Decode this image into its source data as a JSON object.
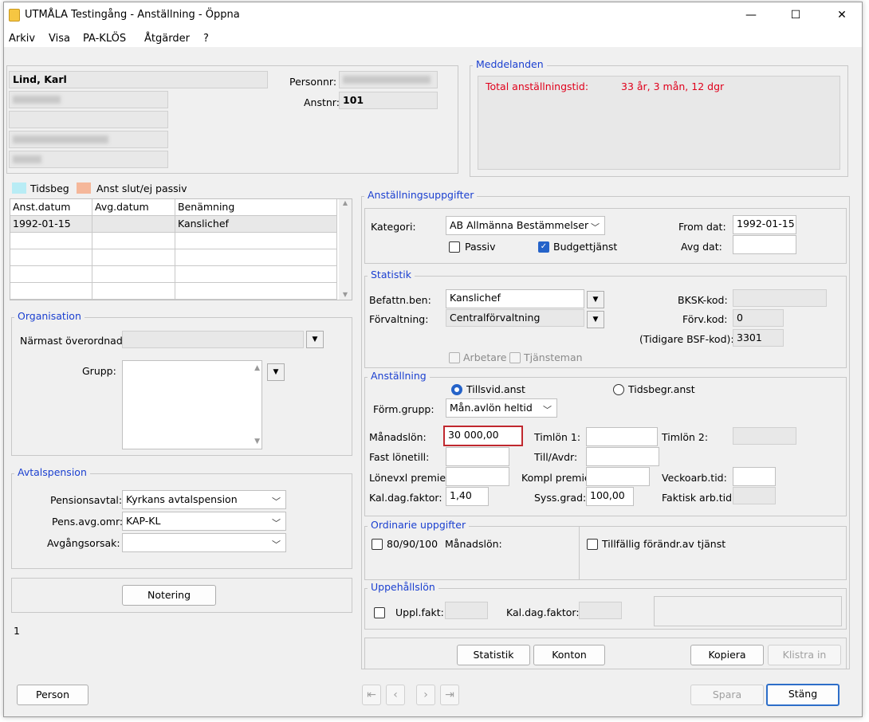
{
  "window": {
    "title": "UTMÅLA Testingång - Anställning - Öppna",
    "minimize": "—",
    "maximize": "☐",
    "close": "✕"
  },
  "menu": [
    "Arkiv",
    "Visa",
    "PA-KLÖS",
    "Åtgärder",
    "?"
  ],
  "person": {
    "name": "Lind, Karl",
    "personnr_label": "Personnr:",
    "anstnr_label": "Anstnr:",
    "anstnr": "101"
  },
  "messages": {
    "title": "Meddelanden",
    "label": "Total anställningstid:",
    "value": "33 år, 3 mån, 12 dgr",
    "color": "#e0001b"
  },
  "legend": {
    "tidsbeg": "Tidsbeg",
    "tidsbeg_color": "#b8ecf5",
    "anst_slut": "Anst slut/ej passiv",
    "anst_slut_color": "#f5b79a"
  },
  "employment_table": {
    "headers": [
      "Anst.datum",
      "Avg.datum",
      "Benämning"
    ],
    "rows": [
      [
        "1992-01-15",
        "",
        "Kanslichef"
      ],
      [
        "",
        "",
        ""
      ],
      [
        "",
        "",
        ""
      ],
      [
        "",
        "",
        ""
      ],
      [
        "",
        "",
        ""
      ]
    ]
  },
  "organisation": {
    "title": "Organisation",
    "narmast_label": "Närmast överordnad:",
    "grupp_label": "Grupp:"
  },
  "avtalspension": {
    "title": "Avtalspension",
    "pensionsavtal_label": "Pensionsavtal:",
    "pensionsavtal": "Kyrkans avtalspension",
    "pens_avg_label": "Pens.avg.omr:",
    "pens_avg": "KAP-KL",
    "avgangsorsak_label": "Avgångsorsak:",
    "avgangsorsak": ""
  },
  "notering_button": "Notering",
  "counter": "1",
  "anstallningsuppgifter": {
    "title": "Anställningsuppgifter",
    "kategori_label": "Kategori:",
    "kategori": "AB Allmänna Bestämmelser",
    "passiv_label": "Passiv",
    "budget_label": "Budgettjänst",
    "from_dat_label": "From dat:",
    "from_dat": "1992-01-15",
    "avg_dat_label": "Avg dat:",
    "avg_dat": ""
  },
  "statistik": {
    "title": "Statistik",
    "befattn_label": "Befattn.ben:",
    "befattn": "Kanslichef",
    "forvaltning_label": "Förvaltning:",
    "forvaltning": "Centralförvaltning",
    "bksk_label": "BKSK-kod:",
    "bksk": "",
    "forv_kod_label": "Förv.kod:",
    "forv_kod": "0",
    "bsf_label": "(Tidigare BSF-kod):",
    "bsf": "3301",
    "arbetare_label": "Arbetare",
    "tjansteman_label": "Tjänsteman"
  },
  "anstallning": {
    "title": "Anställning",
    "tillsvid_label": "Tillsvid.anst",
    "tidsbegr_label": "Tidsbegr.anst",
    "form_grupp_label": "Förm.grupp:",
    "form_grupp": "Mån.avlön heltid",
    "manadslon_label": "Månadslön:",
    "manadslon": "30 000,00",
    "timlon1_label": "Timlön 1:",
    "timlon1": "",
    "timlon2_label": "Timlön 2:",
    "timlon2": "",
    "fast_label": "Fast lönetill:",
    "till_avdr_label": "Till/Avdr:",
    "lonevxl_label": "Lönevxl premie:",
    "kompl_label": "Kompl premie:",
    "veckoarb_label": "Veckoarb.tid:",
    "kal_label": "Kal.dag.faktor:",
    "kal": "1,40",
    "syss_label": "Syss.grad:",
    "syss": "100,00",
    "faktisk_label": "Faktisk arb.tid:",
    "highlight_color": "#c0282e"
  },
  "ordinarie": {
    "title": "Ordinarie uppgifter",
    "cb_80_label": "80/90/100",
    "manadslon_label": "Månadslön:",
    "tillfallig_label": "Tillfällig förändr.av tjänst"
  },
  "uppehallslon": {
    "title": "Uppehållslön",
    "uppl_label": "Uppl.fakt:",
    "kal_label": "Kal.dag.faktor:"
  },
  "buttons": {
    "statistik": "Statistik",
    "konton": "Konton",
    "kopiera": "Kopiera",
    "klistra": "Klistra in",
    "person": "Person",
    "spara": "Spara",
    "stang": "Stäng"
  },
  "nav_icons": [
    "first-icon",
    "prev-icon",
    "next-icon",
    "last-icon"
  ]
}
